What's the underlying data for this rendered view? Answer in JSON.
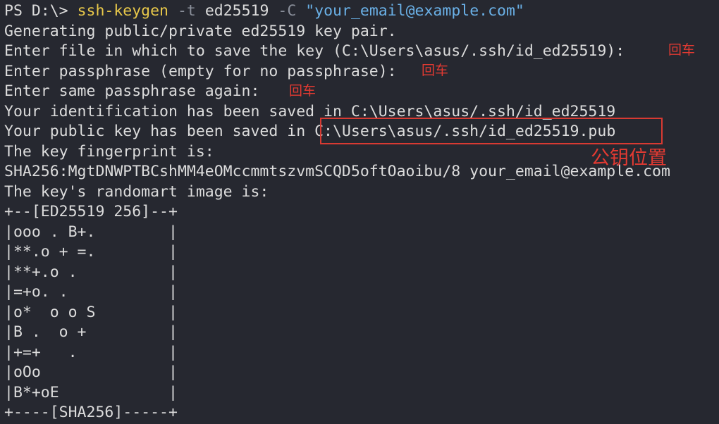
{
  "terminal": {
    "prompt": "PS D:\\> ",
    "command": {
      "program": "ssh-keygen",
      "flag_t": "-t",
      "type_value": "ed25519",
      "flag_c": "-C",
      "comment_value": "\"your_email@example.com\""
    },
    "lines": [
      "Generating public/private ed25519 key pair.",
      "Enter file in which to save the key (C:\\Users\\asus/.ssh/id_ed25519): ",
      "Enter passphrase (empty for no passphrase): ",
      "Enter same passphrase again: ",
      "Your identification has been saved in C:\\Users\\asus/.ssh/id_ed25519",
      "Your public key has been saved in ",
      "The key fingerprint is:",
      "SHA256:MgtDNWPTBCshMM4eOMccmmtszvmSCQD5oftOaoibu/8 your_email@example.com",
      "The key's randomart image is:"
    ],
    "public_key_path": "C:\\Users\\asus/.ssh/id_ed25519.pub",
    "randomart": [
      "+--[ED25519 256]--+",
      "|ooo . B+.        |",
      "|**.o + =.        |",
      "|**+.o .          |",
      "|=+o. .           |",
      "|o*  o o S        |",
      "|B .  o +         |",
      "|+=+   .          |",
      "|oOo              |",
      "|B*+oE            |",
      "+----[SHA256]-----+"
    ]
  },
  "annotations": {
    "enter_key": "回车",
    "public_key_location": "公钥位置",
    "color": "#e23a32"
  }
}
